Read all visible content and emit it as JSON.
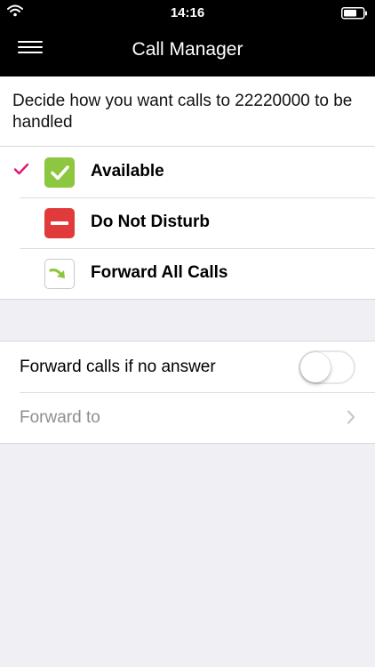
{
  "status_bar": {
    "time": "14:16"
  },
  "nav": {
    "title": "Call Manager"
  },
  "description": "Decide how you want calls to 22220000 to be handled",
  "options": [
    {
      "label": "Available",
      "selected": true
    },
    {
      "label": "Do Not Disturb",
      "selected": false
    },
    {
      "label": "Forward All Calls",
      "selected": false
    }
  ],
  "settings": {
    "forward_no_answer": {
      "label": "Forward calls if no answer",
      "enabled": false
    },
    "forward_to": {
      "label": "Forward to"
    }
  },
  "colors": {
    "accent": "#e0157a",
    "available_green": "#8dc63f",
    "dnd_red": "#e03a3a",
    "forward_arrow": "#8dc63f"
  }
}
